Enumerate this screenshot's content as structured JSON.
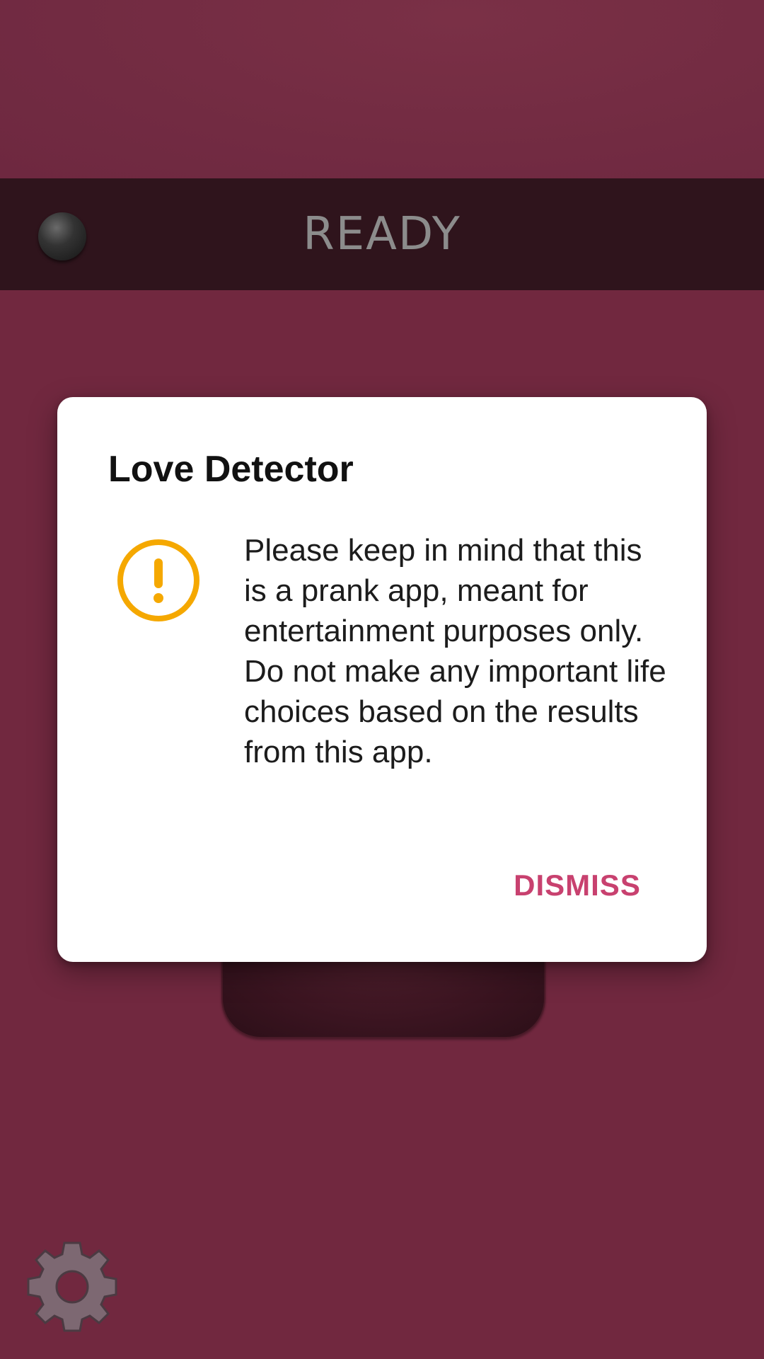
{
  "status": {
    "text": "READY",
    "indicator": "led-off"
  },
  "dialog": {
    "title": "Love Detector",
    "icon": "warning-icon",
    "message": "Please keep in mind that this is a prank app, meant for entertainment purposes only. Do not make any important life choices based on the results from this app.",
    "dismiss_label": "DISMISS"
  },
  "settings": {
    "icon": "gear-icon"
  },
  "colors": {
    "background": "#71283f",
    "status_bar": "#2f141c",
    "accent": "#c8416f",
    "warning": "#f5a800"
  }
}
